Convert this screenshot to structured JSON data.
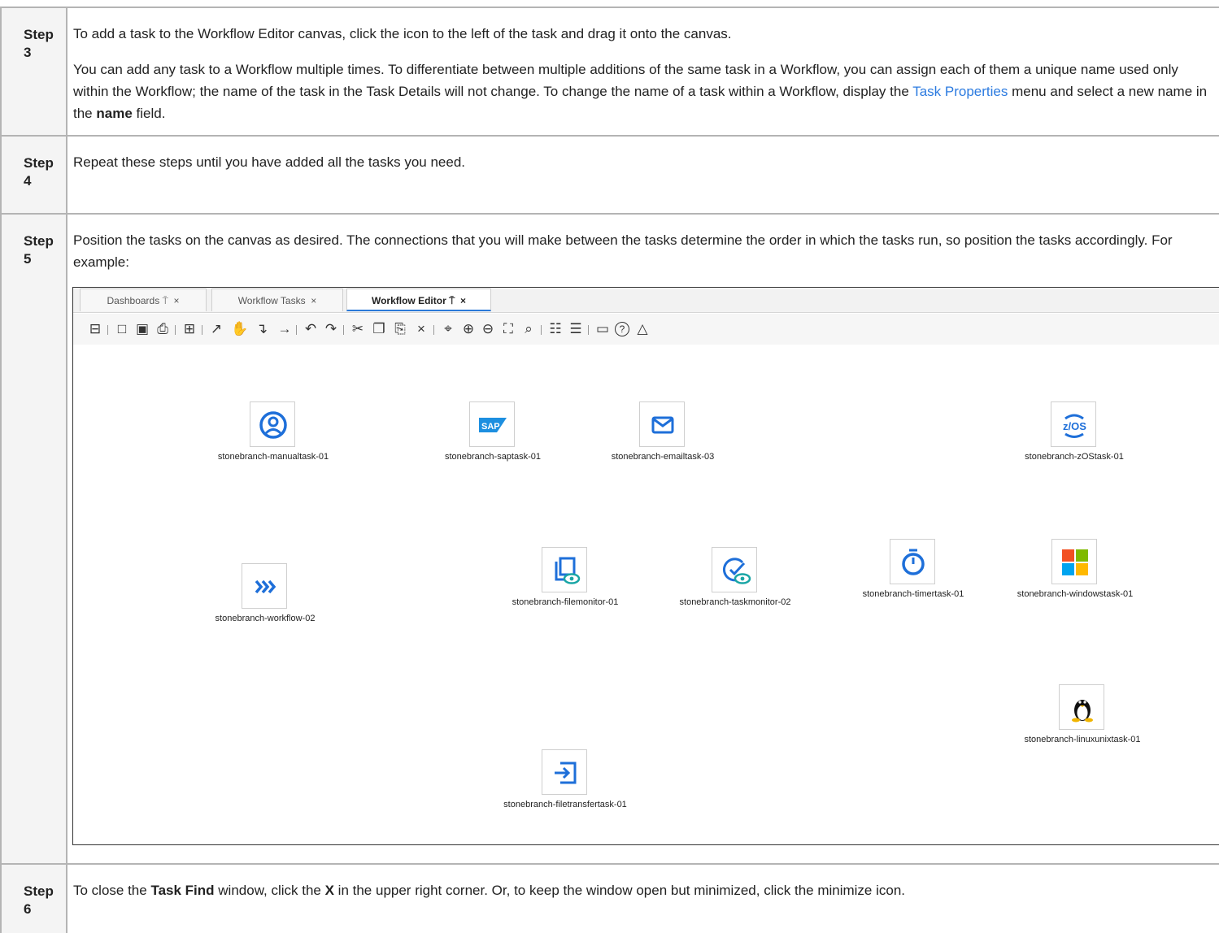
{
  "steps": [
    {
      "label": "Step 3",
      "p1": "To add a task to the Workflow Editor canvas, click the icon to the left of the task and drag it onto the canvas.",
      "p2_a": "You can add any task to a Workflow multiple times. To differentiate between multiple additions of the same task in a Workflow, you can assign each of them a unique name used only within the Workflow; the name of the task in the Task Details will not change. To change the name of a task within a Workflow, display the ",
      "p2_link": "Task Properties",
      "p2_b": " menu and select a new name in the ",
      "p2_bold": "name",
      "p2_c": " field."
    },
    {
      "label": "Step 4",
      "p1": "Repeat these steps until you have added all the tasks you need."
    },
    {
      "label": "Step 5",
      "p1": "Position the tasks on the canvas as desired. The connections that you will make between the tasks determine the order in which the tasks run, so position the tasks accordingly. For example:"
    },
    {
      "label": "Step 6",
      "p1_a": "To close the ",
      "p1_bold1": "Task Find",
      "p1_b": " window, click the ",
      "p1_bold2": "X",
      "p1_c": " in the upper right corner. Or, to keep the window open but minimized, click the minimize icon."
    }
  ],
  "editor": {
    "tabs": [
      {
        "label": "Dashboards",
        "pin": "⍑",
        "close": "×"
      },
      {
        "label": "Workflow Tasks",
        "pin": "",
        "close": "×"
      },
      {
        "label": "Workflow Editor",
        "pin": "⍑",
        "close": "×"
      }
    ],
    "toolbar_icons": [
      "⊟",
      "□",
      "▣",
      "⎙",
      "⊞",
      "↗",
      "✋",
      "↴",
      "→",
      "↶",
      "↷",
      "✂",
      "❐",
      "⎘",
      "×",
      "⌖",
      "⊕",
      "⊖",
      "⛶",
      "⌕",
      "☷",
      "☰",
      "▭",
      "?",
      "△"
    ],
    "nodes": [
      {
        "name": "stonebranch-manualtask-01",
        "icon": "manual"
      },
      {
        "name": "stonebranch-saptask-01",
        "icon": "sap"
      },
      {
        "name": "stonebranch-emailtask-03",
        "icon": "email"
      },
      {
        "name": "stonebranch-zOStask-01",
        "icon": "zos"
      },
      {
        "name": "stonebranch-workflow-02",
        "icon": "workflow"
      },
      {
        "name": "stonebranch-filemonitor-01",
        "icon": "filemonitor"
      },
      {
        "name": "stonebranch-taskmonitor-02",
        "icon": "taskmonitor"
      },
      {
        "name": "stonebranch-timertask-01",
        "icon": "timer"
      },
      {
        "name": "stonebranch-windowstask-01",
        "icon": "windows"
      },
      {
        "name": "stonebranch-linuxunixtask-01",
        "icon": "linux"
      },
      {
        "name": "stonebranch-filetransfertask-01",
        "icon": "filetransfer"
      }
    ],
    "colors": {
      "accent": "#2a7ad9",
      "icon_blue": "#1e6fd9",
      "sap_blue": "#1d8fe0"
    }
  }
}
